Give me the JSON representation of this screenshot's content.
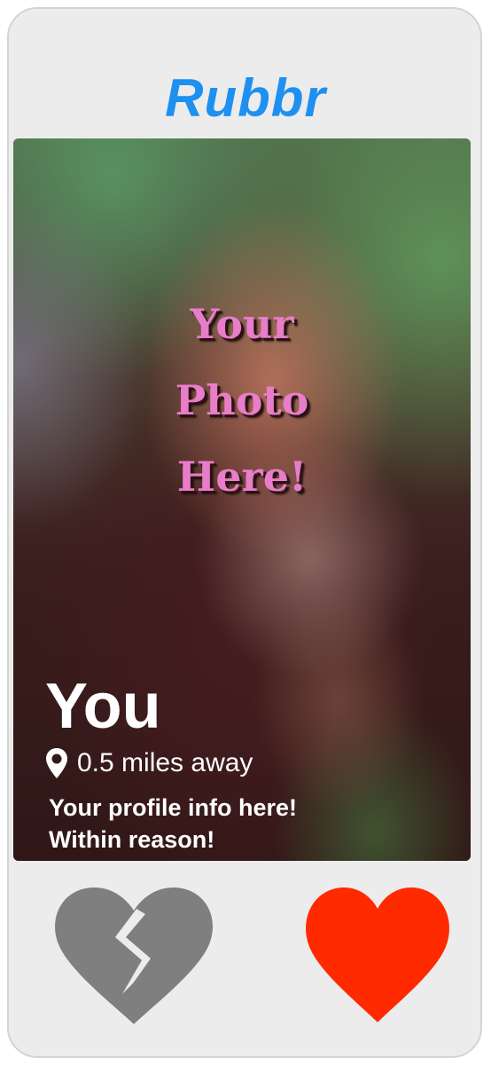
{
  "app": {
    "title": "Rubbr",
    "brand_color": "#1e90f0"
  },
  "profile": {
    "photo_caption": [
      "Your",
      "Photo",
      "Here!"
    ],
    "name": "You",
    "distance": "0.5 miles away",
    "bio": [
      "Your profile info here!",
      "Within reason!"
    ]
  },
  "actions": {
    "dislike": {
      "icon": "broken-heart-icon",
      "color": "#7f7f7f"
    },
    "like": {
      "icon": "heart-icon",
      "color": "#ff2a00"
    }
  },
  "icons": {
    "location": "location-pin-icon"
  }
}
